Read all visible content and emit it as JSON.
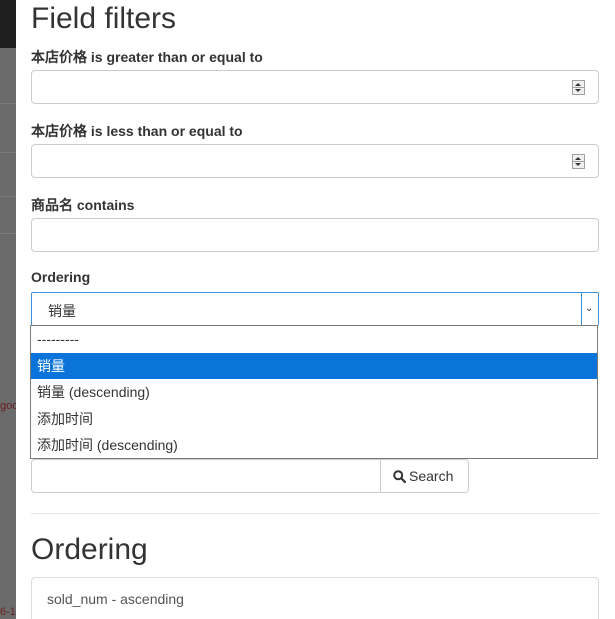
{
  "background": {
    "left_text_1": "goo",
    "left_text_2": "6-1"
  },
  "field_filters": {
    "title": "Field filters",
    "price_gte_label": "本店价格 is greater than or equal to",
    "price_gte_value": "",
    "price_lte_label": "本店价格 is less than or equal to",
    "price_lte_value": "",
    "name_contains_label": "商品名 contains",
    "name_contains_value": "",
    "ordering_label": "Ordering",
    "ordering_selected": "销量",
    "ordering_options": [
      {
        "label": "---------",
        "selected": false
      },
      {
        "label": "销量",
        "selected": true
      },
      {
        "label": "销量 (descending)",
        "selected": false
      },
      {
        "label": "添加时间",
        "selected": false
      },
      {
        "label": "添加时间 (descending)",
        "selected": false
      }
    ]
  },
  "search": {
    "value": "",
    "button_label": "Search"
  },
  "ordering_section": {
    "title": "Ordering",
    "items": [
      "sold_num - ascending"
    ]
  },
  "colors": {
    "highlight": "#0a74da",
    "focus_border": "#3f8fd8"
  }
}
